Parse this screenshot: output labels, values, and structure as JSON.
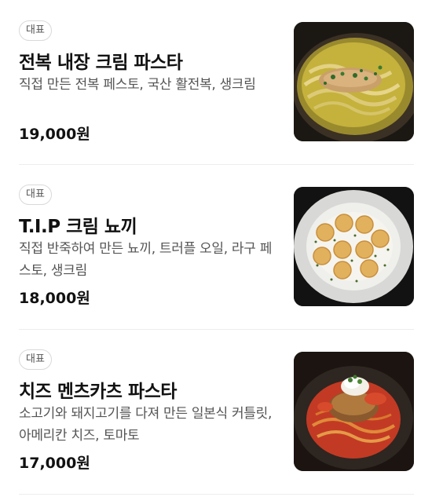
{
  "menu": {
    "items": [
      {
        "badge": "대표",
        "name": "전복 내장 크림 파스타",
        "description": "직접 만든 전복 페스토, 국산 활전복, 생크림",
        "price": "19,000원",
        "image": "abalone-cream-pasta-photo"
      },
      {
        "badge": "대표",
        "name": "T.I.P 크림 뇨끼",
        "description": "직접 반죽하여 만든 뇨끼, 트러플 오일, 라구 페스토, 생크림",
        "price": "18,000원",
        "image": "cream-gnocchi-photo"
      },
      {
        "badge": "대표",
        "name": "치즈 멘츠카츠 파스타",
        "description": "소고기와 돼지고기를 다져 만든 일본식 커틀릿, 아메리칸 치즈, 토마토",
        "price": "17,000원",
        "image": "cheese-menchi-katsu-pasta-photo"
      }
    ]
  }
}
